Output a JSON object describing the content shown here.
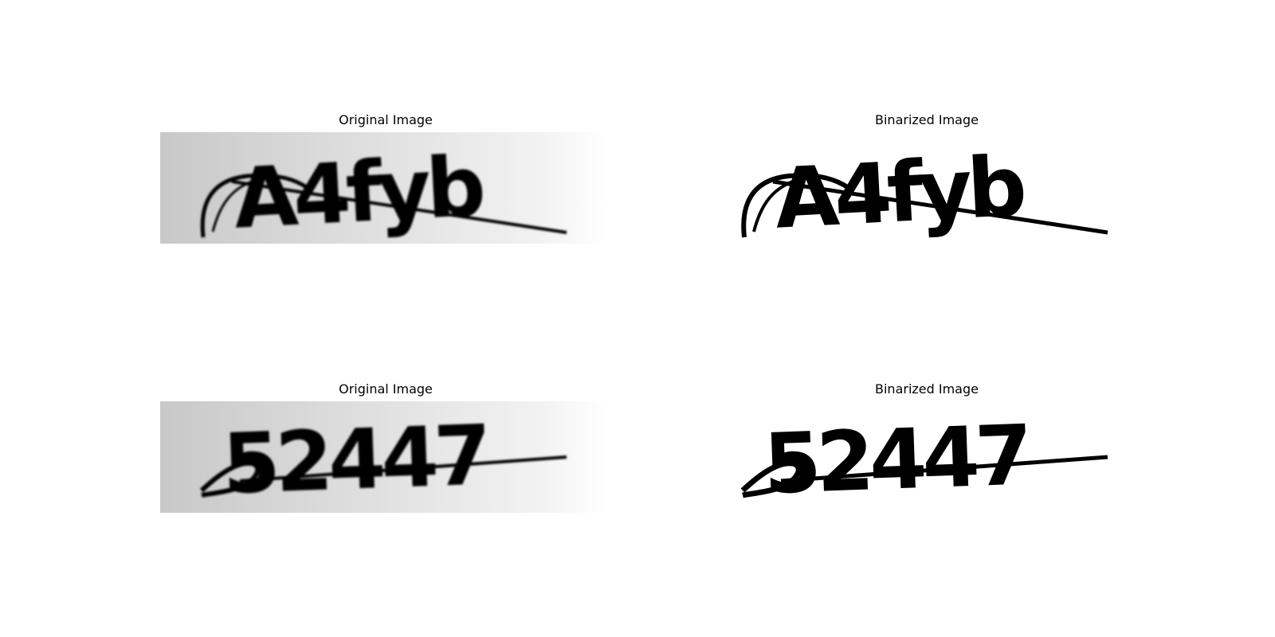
{
  "panels": [
    {
      "title": "Original Image",
      "captcha": "A4fyb",
      "style": "original"
    },
    {
      "title": "Binarized Image",
      "captcha": "A4fyb",
      "style": "binarized"
    },
    {
      "title": "Original Image",
      "captcha": "52447",
      "style": "original"
    },
    {
      "title": "Binarized Image",
      "captcha": "52447",
      "style": "binarized"
    }
  ],
  "colors": {
    "ink": "#000000",
    "background": "#ffffff",
    "gradient_start": "#c8c8c8",
    "gradient_end": "#ffffff"
  }
}
